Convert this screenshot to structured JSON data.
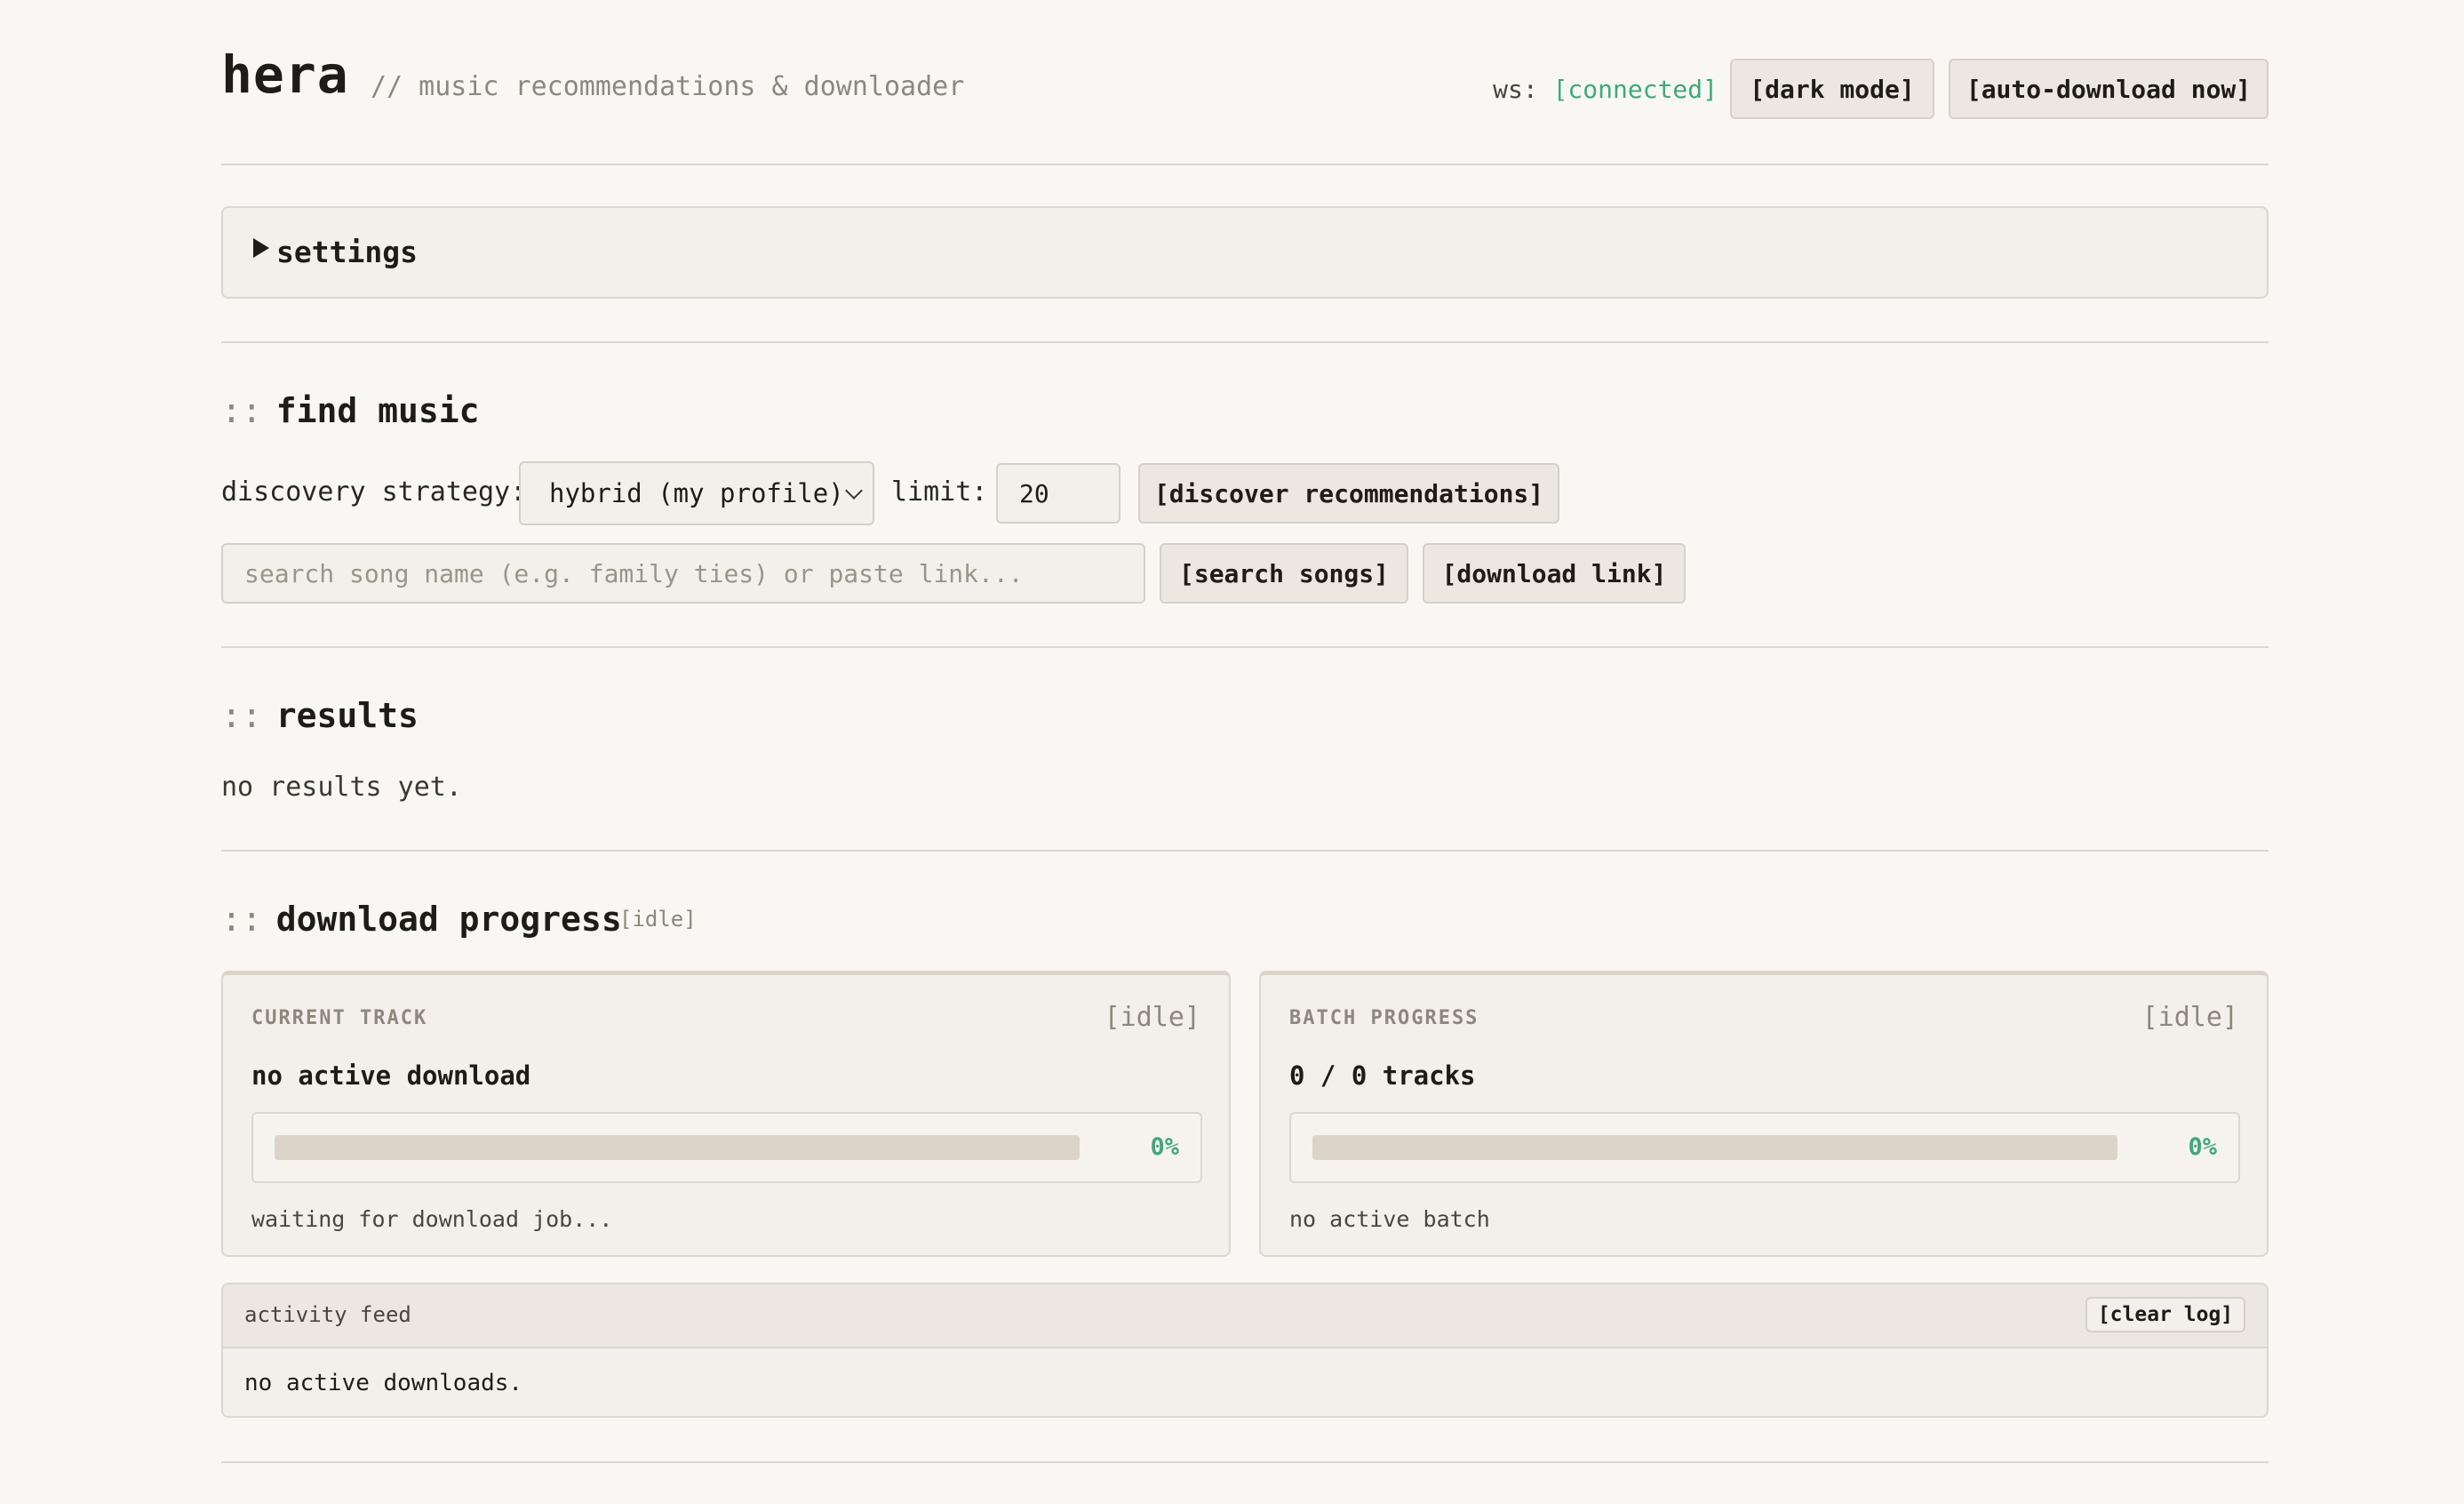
{
  "header": {
    "title": "hera",
    "subtitle": "// music recommendations & downloader",
    "ws_label": "ws:",
    "ws_status": "[connected]",
    "dark_mode_button": "[dark mode]",
    "auto_download_button": "[auto-download now]"
  },
  "settings": {
    "label": "settings",
    "expanded": false
  },
  "find_music": {
    "prefix": "::",
    "title": "find music",
    "strategy_label": "discovery strategy:",
    "strategy_selected": "hybrid (my profile)",
    "limit_label": "limit:",
    "limit_value": "20",
    "discover_button": "[discover recommendations]",
    "search_placeholder": "search song name (e.g. family ties) or paste link...",
    "search_value": "",
    "search_button": "[search songs]",
    "download_link_button": "[download link]"
  },
  "results": {
    "prefix": "::",
    "title": "results",
    "empty_text": "no results yet."
  },
  "download_progress": {
    "prefix": "::",
    "title": "download progress",
    "badge": "[idle]",
    "current_track": {
      "kicker": "CURRENT TRACK",
      "state": "[idle]",
      "headline": "no active download",
      "percent_label": "0%",
      "progress_fraction": 0,
      "note": "waiting for download job..."
    },
    "batch": {
      "kicker": "BATCH PROGRESS",
      "state": "[idle]",
      "headline": "0 / 0 tracks",
      "percent_label": "0%",
      "progress_fraction": 0,
      "note": "no active batch"
    }
  },
  "activity_feed": {
    "title": "activity feed",
    "clear_button": "[clear log]",
    "body": "no active downloads."
  },
  "colors": {
    "accent_green": "#3fa97a",
    "background": "#f8f7f4",
    "panel": "#f3f0eb",
    "border": "#dcd7cf",
    "muted_text": "#8d877d"
  }
}
